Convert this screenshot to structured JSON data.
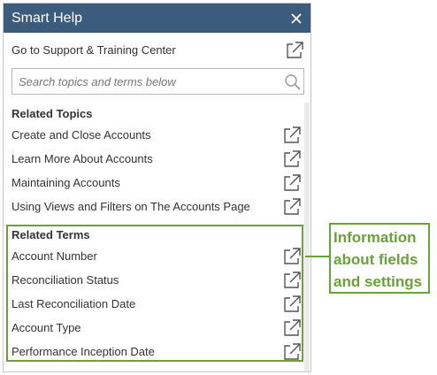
{
  "window": {
    "title": "Smart Help"
  },
  "support": {
    "label": "Go to Support & Training Center"
  },
  "search": {
    "placeholder": "Search topics and terms below",
    "value": ""
  },
  "related_topics": {
    "heading": "Related Topics",
    "items": [
      {
        "label": "Create and Close Accounts"
      },
      {
        "label": "Learn More About Accounts"
      },
      {
        "label": "Maintaining Accounts"
      },
      {
        "label": "Using Views and Filters on The Accounts Page"
      }
    ]
  },
  "related_terms": {
    "heading": "Related Terms",
    "items": [
      {
        "label": "Account Number"
      },
      {
        "label": "Reconciliation Status"
      },
      {
        "label": "Last Reconciliation Date"
      },
      {
        "label": "Account Type"
      },
      {
        "label": "Performance Inception Date"
      }
    ]
  },
  "callout": {
    "lines": [
      "Information",
      "about fields",
      "and settings"
    ]
  },
  "icons": {
    "close": "close-icon",
    "external_link": "external-link-icon",
    "search": "search-icon"
  },
  "colors": {
    "header": "#3c5c7e",
    "highlight": "#6aa13a",
    "text": "#333333"
  }
}
